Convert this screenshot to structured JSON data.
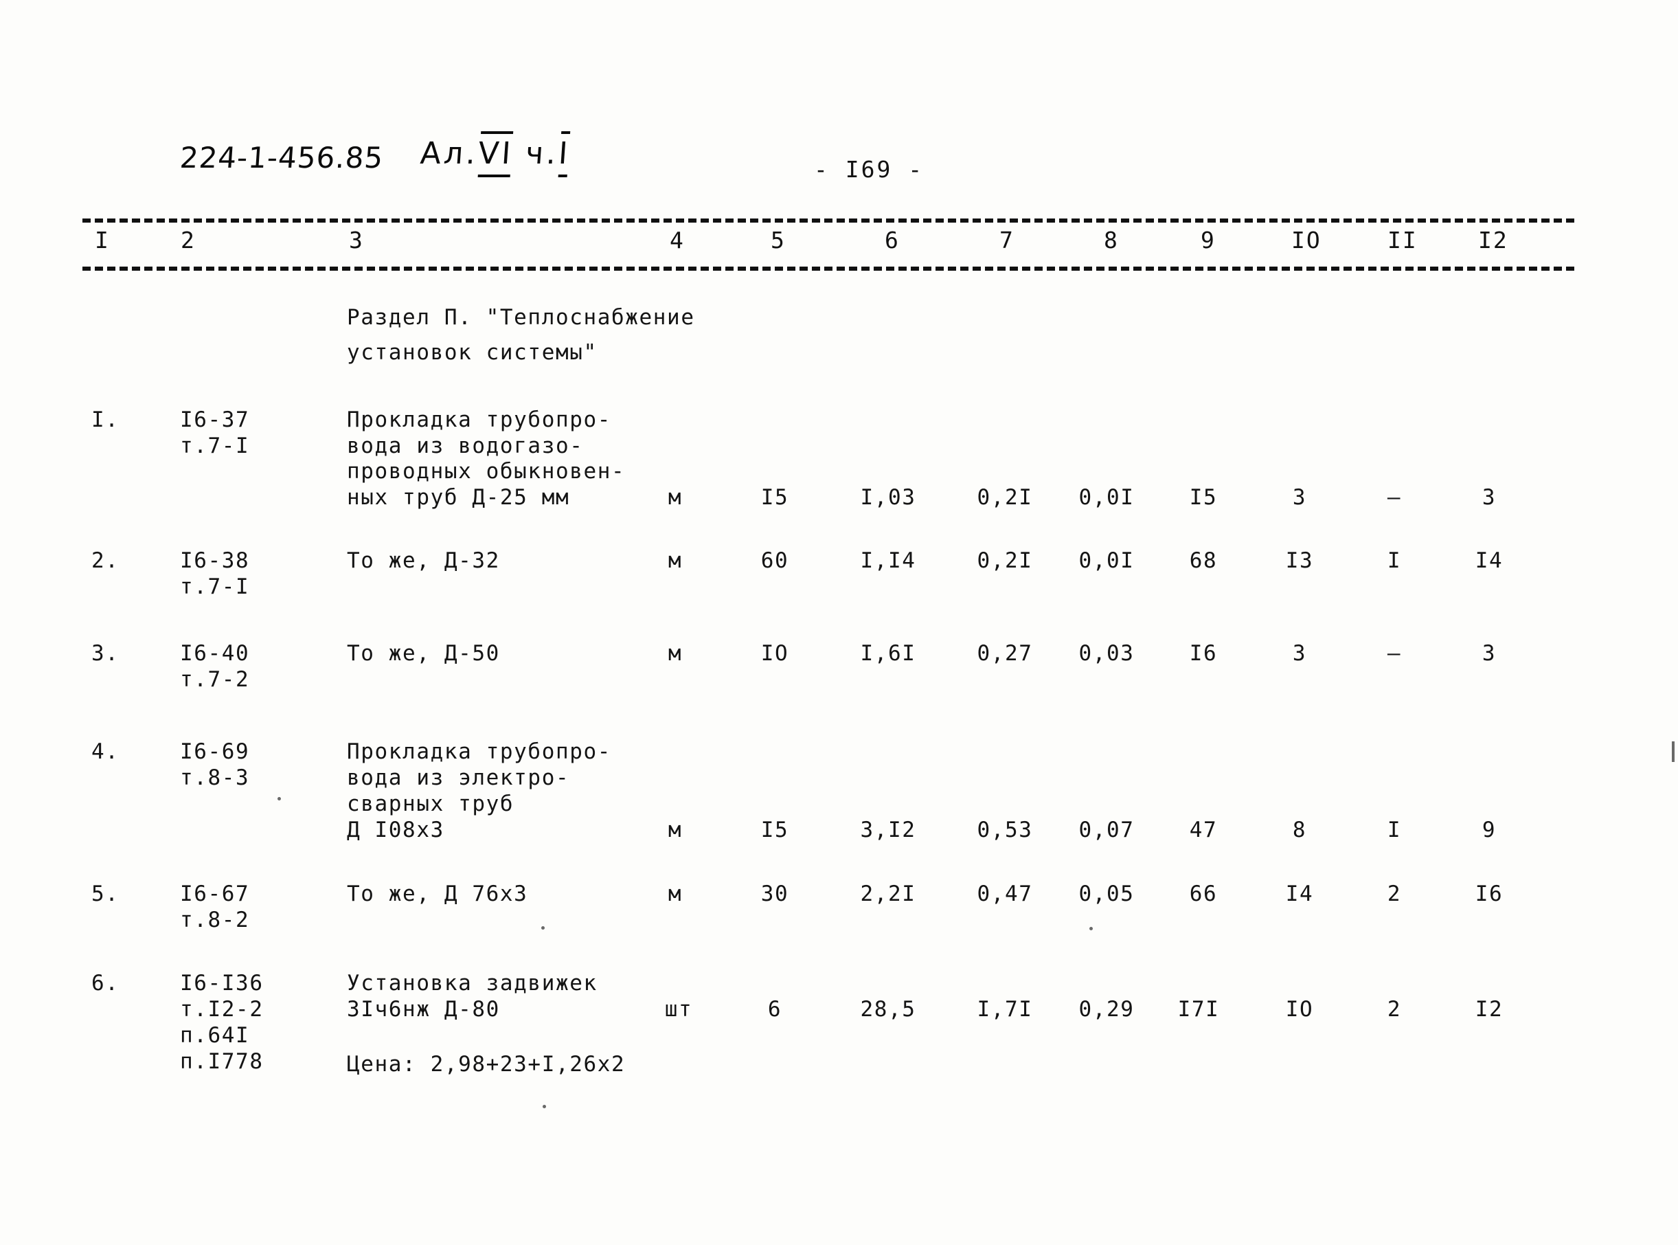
{
  "header": {
    "handwritten_code": "224-1-456.85",
    "handwritten_album_prefix": "Ал.",
    "handwritten_album_roman": "VI",
    "handwritten_part_prefix": "ч.",
    "handwritten_part_num": "I",
    "page_number": "- I69 -"
  },
  "table": {
    "column_numbers": [
      "I",
      "2",
      "3",
      "4",
      "5",
      "6",
      "7",
      "8",
      "9",
      "IO",
      "II",
      "I2"
    ],
    "section_title_line1": "Раздел П. \"Теплоснабжение",
    "section_title_line2": "установок системы\"",
    "rows": [
      {
        "no": "I.",
        "code_lines": [
          "I6-37",
          "т.7-I"
        ],
        "desc_lines": [
          "Прокладка трубопро-",
          "вода из водогазо-",
          "проводных обыкновен-",
          "ных труб Д-25 мм"
        ],
        "unit": "м",
        "qty": "I5",
        "c6": "I,03",
        "c7": "0,2I",
        "c8": "0,0I",
        "c9": "I5",
        "c10": "3",
        "c11": "–",
        "c12": "3"
      },
      {
        "no": "2.",
        "code_lines": [
          "I6-38",
          "т.7-I"
        ],
        "desc_lines": [
          "То же, Д-32"
        ],
        "unit": "м",
        "qty": "60",
        "c6": "I,I4",
        "c7": "0,2I",
        "c8": "0,0I",
        "c9": "68",
        "c10": "I3",
        "c11": "I",
        "c12": "I4"
      },
      {
        "no": "3.",
        "code_lines": [
          "I6-40",
          "т.7-2"
        ],
        "desc_lines": [
          "То же, Д-50"
        ],
        "unit": "м",
        "qty": "IO",
        "c6": "I,6I",
        "c7": "0,27",
        "c8": "0,03",
        "c9": "I6",
        "c10": "3",
        "c11": "–",
        "c12": "3"
      },
      {
        "no": "4.",
        "code_lines": [
          "I6-69",
          "т.8-3"
        ],
        "desc_lines": [
          "Прокладка трубопро-",
          "вода из электро-",
          "сварных труб",
          "Д I08х3"
        ],
        "unit": "м",
        "qty": "I5",
        "c6": "3,I2",
        "c7": "0,53",
        "c8": "0,07",
        "c9": "47",
        "c10": "8",
        "c11": "I",
        "c12": "9"
      },
      {
        "no": "5.",
        "code_lines": [
          "I6-67",
          "т.8-2"
        ],
        "desc_lines": [
          "То же, Д 76х3"
        ],
        "unit": "м",
        "qty": "30",
        "c6": "2,2I",
        "c7": "0,47",
        "c8": "0,05",
        "c9": "66",
        "c10": "I4",
        "c11": "2",
        "c12": "I6"
      },
      {
        "no": "6.",
        "code_lines": [
          "I6-I36",
          "т.I2-2",
          "п.64I",
          "п.I778"
        ],
        "desc_lines": [
          "Установка задвижек",
          "3Iч6нж Д-80"
        ],
        "price_note": "Цена: 2,98+23+I,26х2",
        "unit": "шт",
        "qty": "6",
        "c6": "28,5",
        "c7": "I,7I",
        "c8": "0,29",
        "c9": "I7I",
        "c10": "IO",
        "c11": "2",
        "c12": "I2"
      }
    ]
  }
}
